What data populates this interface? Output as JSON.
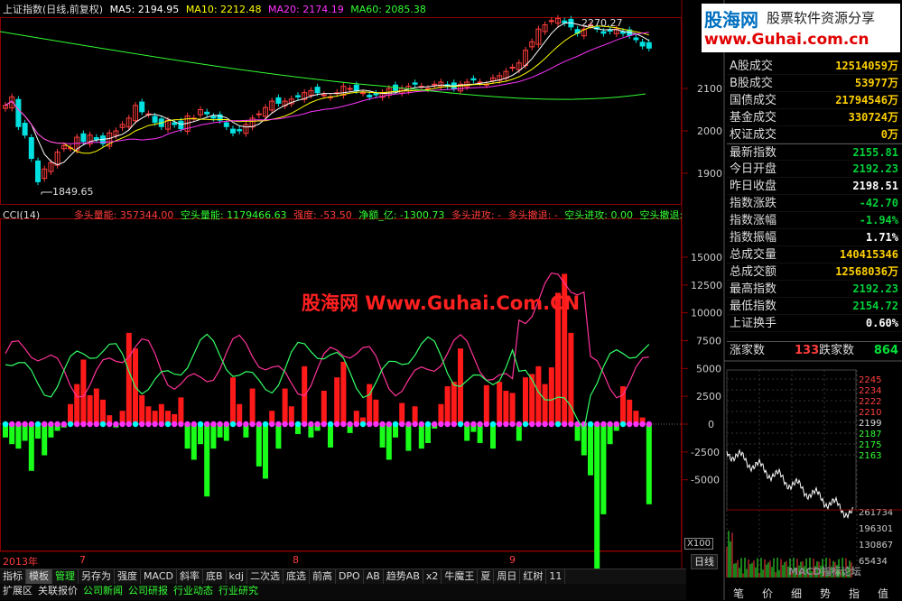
{
  "main_header": {
    "title": "上证指数(日线,前复权)",
    "ma5": "MA5: 2194.95",
    "ma10": "MA10: 2212.48",
    "ma20": "MA20: 2174.19",
    "ma60": "MA60: 2085.38"
  },
  "price_ticks": [
    "2100",
    "2000",
    "1900"
  ],
  "annotations": {
    "high": "2270.27",
    "low": "1849.65"
  },
  "cci_header": {
    "title": "CCI(14)",
    "bull_vol": "多头量能: 357344.00",
    "bear_vol": "空头量能: 1179466.63",
    "strength": "强度: -53.50",
    "net": "净额_亿: -1300.73",
    "bull_in": "多头进攻: -",
    "bull_out": "多头撤退: -",
    "bear_in": "空头进攻: 0.00",
    "bear_out": "空头撤退:"
  },
  "cci_ticks": [
    "15000",
    "12500",
    "10000",
    "7500",
    "5000",
    "2500",
    "0",
    "-2500",
    "-5000"
  ],
  "x_axis": {
    "year": "2013年",
    "m7": "7",
    "m8": "8",
    "m9": "9",
    "scale": "X100"
  },
  "watermark": "股海网 Www.Guhai.Com.CN",
  "logo": {
    "name": "股海网",
    "slogan": "股票软件资源分享",
    "url": "www.Guhai.com.cn"
  },
  "quote_rows": [
    {
      "label": "A股成交",
      "value": "12514059万",
      "cls": ""
    },
    {
      "label": "B股成交",
      "value": "53977万",
      "cls": ""
    },
    {
      "label": "国债成交",
      "value": "21794546万",
      "cls": ""
    },
    {
      "label": "基金成交",
      "value": "330724万",
      "cls": ""
    },
    {
      "label": "权证成交",
      "value": "0万",
      "cls": ""
    },
    {
      "label": "最新指数",
      "value": "2155.81",
      "cls": "dn"
    },
    {
      "label": "今日开盘",
      "value": "2192.23",
      "cls": "dn"
    },
    {
      "label": "昨日收盘",
      "value": "2198.51",
      "cls": "wt"
    },
    {
      "label": "指数涨跌",
      "value": "-42.70",
      "cls": "dn"
    },
    {
      "label": "指数涨幅",
      "value": "-1.94%",
      "cls": "dn"
    },
    {
      "label": "指数振幅",
      "value": "1.71%",
      "cls": "wt"
    },
    {
      "label": "总成交量",
      "value": "140415346",
      "cls": ""
    },
    {
      "label": "总成交额",
      "value": "12568036万",
      "cls": ""
    },
    {
      "label": "最高指数",
      "value": "2192.23",
      "cls": "dn"
    },
    {
      "label": "最低指数",
      "value": "2154.72",
      "cls": "dn"
    },
    {
      "label": "上证换手",
      "value": "0.60%",
      "cls": "wt"
    }
  ],
  "breadth": {
    "up_label": "涨家数",
    "up_value": "133",
    "down_label": "跌家数",
    "down_value": "864"
  },
  "mini_ticks": [
    "2245",
    "2234",
    "2222",
    "2210",
    "2199",
    "2187",
    "2175",
    "2163",
    "261734",
    "196301",
    "130867",
    "65434"
  ],
  "period_tab": "日线",
  "bottom_tabs": [
    "笔",
    "价",
    "细",
    "势",
    "指",
    "值"
  ],
  "bottom_watermark": "MACD指标论坛",
  "toolbar1": [
    "指标",
    "模板",
    "管理",
    "另存为",
    "强度",
    "MACD",
    "斜率",
    "底B",
    "kdj",
    "二次选",
    "底选",
    "前高",
    "DPO",
    "AB",
    "趋势AB",
    "x2",
    "牛魔王",
    "夏",
    "周日",
    "红树",
    "11"
  ],
  "toolbar2": [
    "扩展区",
    "关联报价",
    "公司新闻",
    "公司研报",
    "行业动态",
    "行业研究"
  ],
  "colors": {
    "up": "#ff3c3c",
    "down": "#00e0e0",
    "ma5": "#ffffff",
    "ma10": "#ffff00",
    "ma20": "#ff33ff",
    "ma60": "#33ff33",
    "cci_line": "#ff3399",
    "green_line": "#33ff66"
  }
}
